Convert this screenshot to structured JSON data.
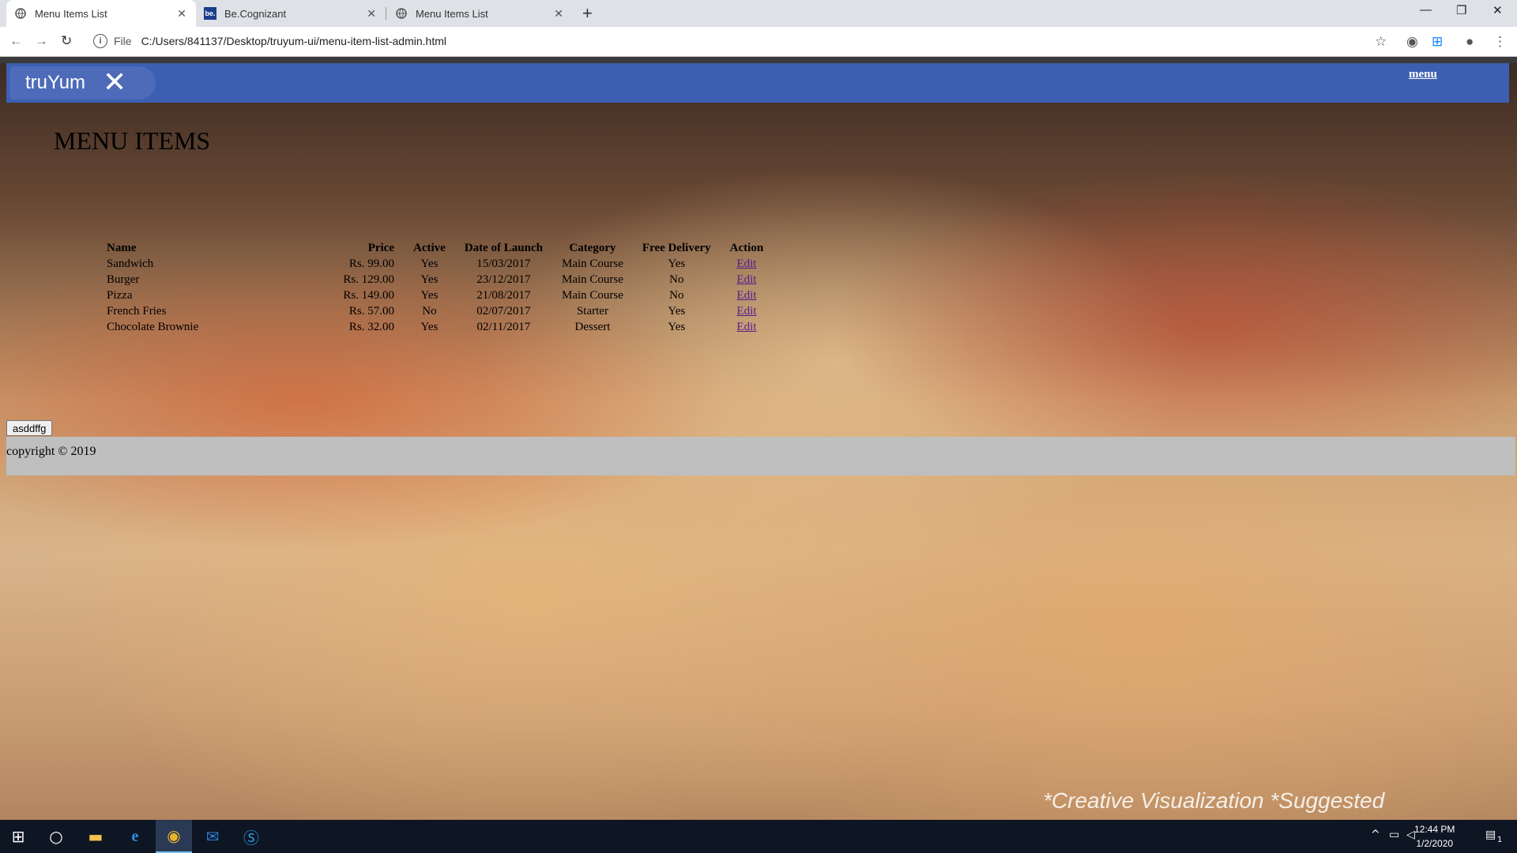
{
  "browser": {
    "tabs": [
      {
        "title": "Menu Items List",
        "active": true
      },
      {
        "title": "Be.Cognizant",
        "active": false
      },
      {
        "title": "Menu Items List",
        "active": false
      }
    ],
    "new_tab_symbol": "+",
    "address": {
      "scheme_label": "File",
      "url": "C:/Users/841137/Desktop/truyum-ui/menu-item-list-admin.html"
    }
  },
  "page": {
    "brand": "truYum",
    "nav_link": "menu",
    "title": "MENU ITEMS",
    "table": {
      "headers": [
        "Name",
        "Price",
        "Active",
        "Date of Launch",
        "Category",
        "Free Delivery",
        "Action"
      ],
      "rows": [
        [
          "Sandwich",
          "Rs. 99.00",
          "Yes",
          "15/03/2017",
          "Main Course",
          "Yes",
          "Edit"
        ],
        [
          "Burger",
          "Rs. 129.00",
          "Yes",
          "23/12/2017",
          "Main Course",
          "No",
          "Edit"
        ],
        [
          "Pizza",
          "Rs. 149.00",
          "Yes",
          "21/08/2017",
          "Main Course",
          "No",
          "Edit"
        ],
        [
          "French Fries",
          "Rs. 57.00",
          "No",
          "02/07/2017",
          "Starter",
          "Yes",
          "Edit"
        ],
        [
          "Chocolate Brownie",
          "Rs. 32.00",
          "Yes",
          "02/11/2017",
          "Dessert",
          "Yes",
          "Edit"
        ]
      ]
    },
    "button_label": "asddffg",
    "footer": "copyright © 2019",
    "watermark": "*Creative Visualization  *Suggested"
  },
  "taskbar": {
    "time": "12:44 PM",
    "date": "1/2/2020",
    "notification_count": "1"
  },
  "colors": {
    "navbar": "#3c5fb1",
    "footer": "#bfbfbf",
    "taskbar": "#0e1624"
  }
}
